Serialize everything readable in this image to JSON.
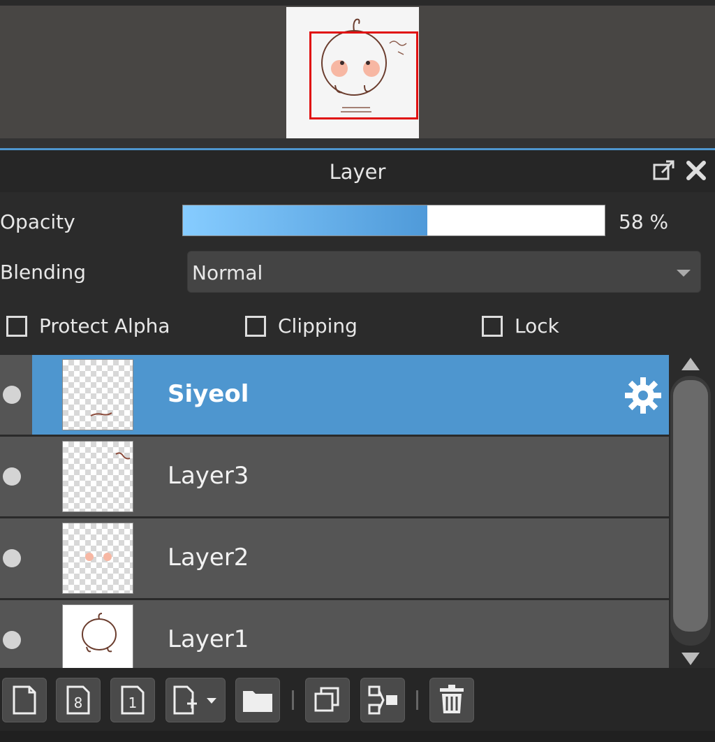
{
  "navigator": {
    "preview_icon": "navigator-canvas-preview",
    "viewport_color": "#e01010"
  },
  "panel": {
    "title": "Layer",
    "accent_color": "#4e96cf",
    "popout_icon": "popout-icon",
    "close_icon": "close-icon"
  },
  "opacity": {
    "label": "Opacity",
    "value_text": "58 %",
    "value": 58
  },
  "blending": {
    "label": "Blending",
    "selected": "Normal"
  },
  "options": {
    "protect_alpha": "Protect Alpha",
    "clipping": "Clipping",
    "lock": "Lock"
  },
  "layers": [
    {
      "name": "Siyeol",
      "selected": true,
      "settings_icon": "gear-icon"
    },
    {
      "name": "Layer3",
      "selected": false
    },
    {
      "name": "Layer2",
      "selected": false
    },
    {
      "name": "Layer1",
      "selected": false
    }
  ],
  "toolbar": {
    "buttons": [
      "new-layer-icon",
      "new-8bit-layer-icon",
      "new-1bit-layer-icon",
      "add-layer-menu-icon",
      "new-folder-icon",
      "duplicate-layer-icon",
      "merge-layer-icon",
      "delete-layer-icon"
    ]
  }
}
